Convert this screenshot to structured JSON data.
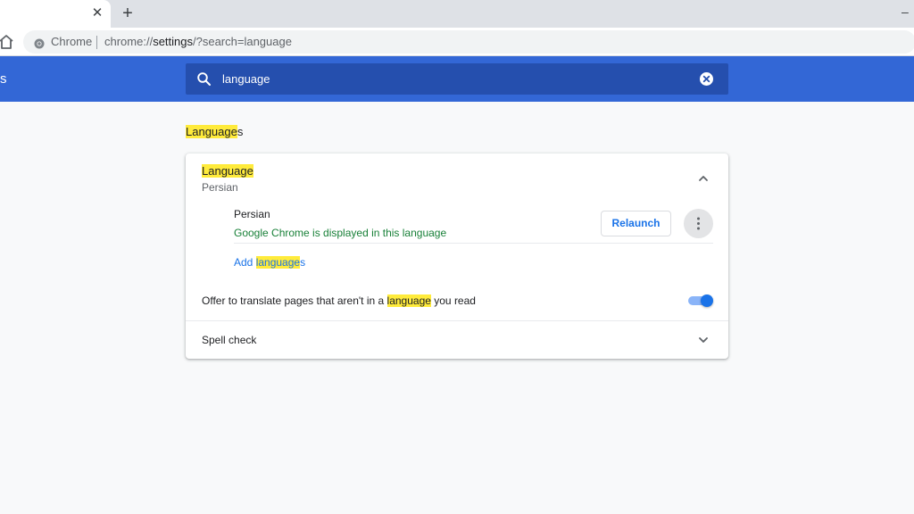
{
  "browser": {
    "tab_close_glyph": "✕",
    "new_tab_glyph": "+",
    "minimize_glyph": "–",
    "omnibox": {
      "site_chip": "Chrome",
      "url_scheme": "chrome://",
      "url_host": "settings",
      "url_path": "/?search=language"
    }
  },
  "header": {
    "title_fragment": "s",
    "search": {
      "value": "language"
    }
  },
  "section": {
    "title_highlight": "Language",
    "title_rest": "s"
  },
  "language_card": {
    "label_highlight": "Language",
    "current_language": "Persian",
    "item": {
      "name": "Persian",
      "status": "Google Chrome is displayed in this language",
      "relaunch_label": "Relaunch"
    },
    "add_link_prefix": "Add ",
    "add_link_highlight": "language",
    "add_link_suffix": "s"
  },
  "translate_row": {
    "label_before": "Offer to translate pages that aren't in a ",
    "label_highlight": "language",
    "label_after": " you read",
    "enabled": true
  },
  "spell_check": {
    "label": "Spell check"
  },
  "colors": {
    "header_blue": "#3367d6",
    "search_bg": "#254fae",
    "highlight": "#ffeb3b",
    "link_blue": "#1a73e8",
    "status_green": "#188038"
  },
  "icons": {
    "home": "home-icon",
    "site": "chrome-logo-icon",
    "search": "search-icon",
    "clear": "clear-circle-icon",
    "expand_less": "chevron-up-icon",
    "more": "more-vert-icon",
    "expand_more": "chevron-down-icon"
  }
}
